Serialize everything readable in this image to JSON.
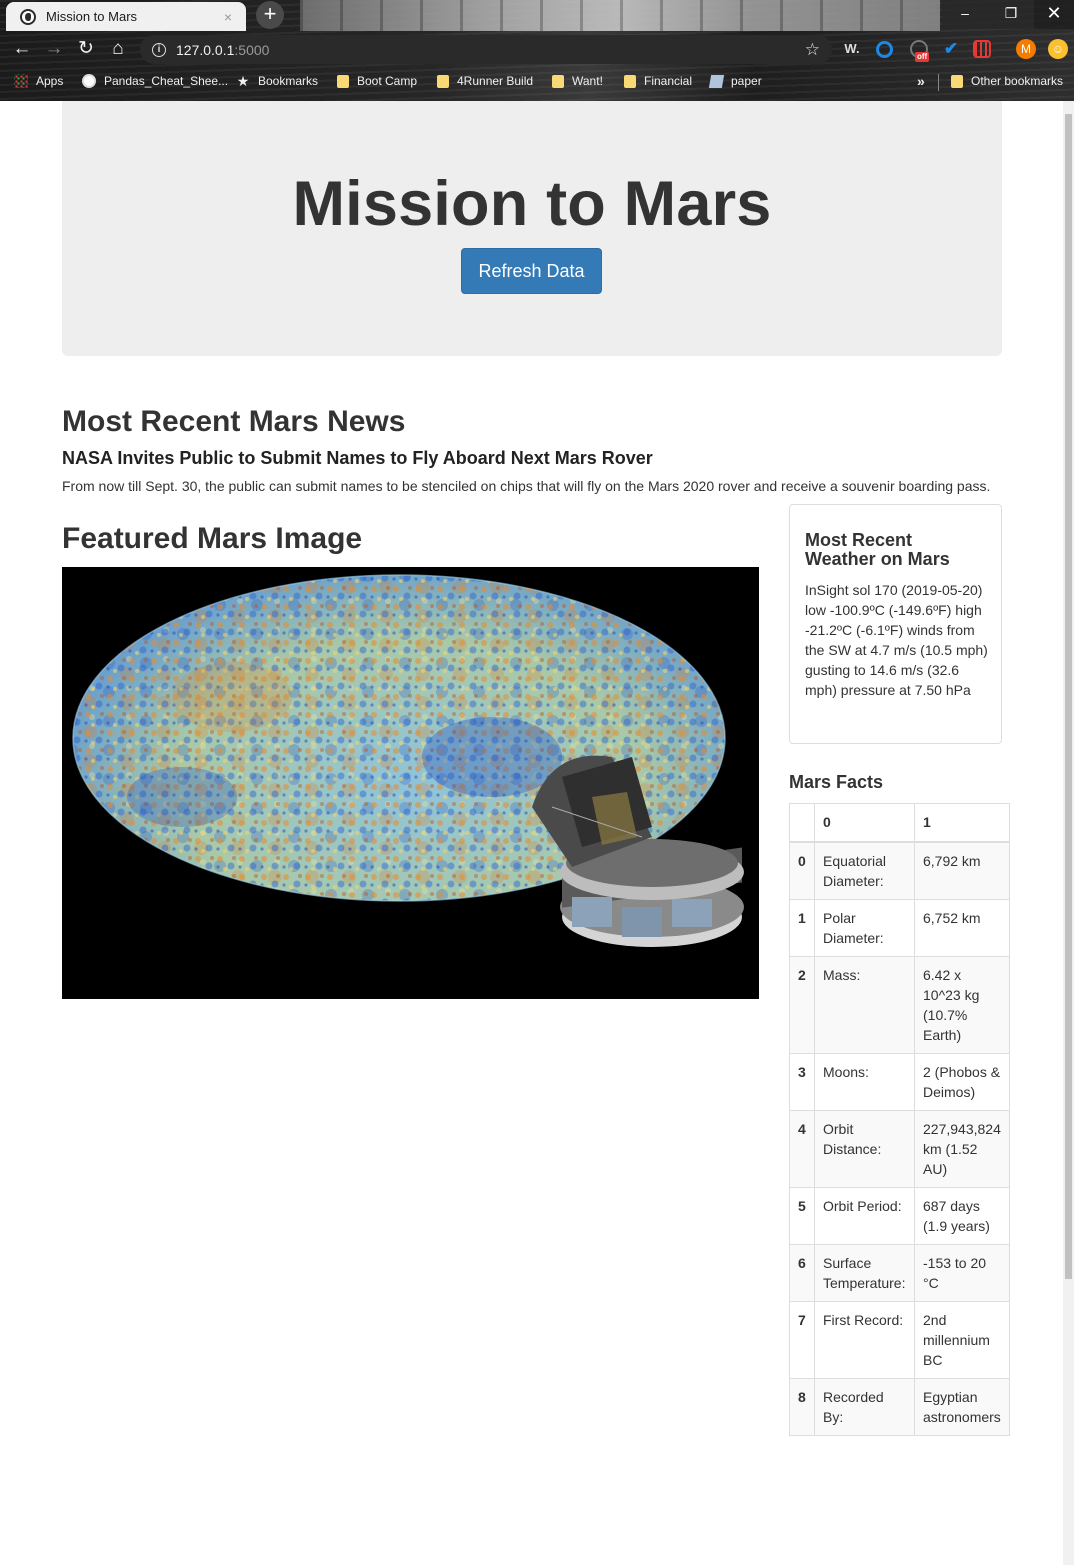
{
  "browser": {
    "tab_title": "Mission to Mars",
    "tab_close": "×",
    "new_tab": "+",
    "url_host": "127.0.0.1",
    "url_port": ":5000",
    "window_controls": {
      "minimize": "–",
      "maximize": "❐",
      "close": "✕"
    },
    "extensions": {
      "w": "W.",
      "off_badge": "off",
      "avatar": "M",
      "smile": "☺"
    },
    "bookmarks": [
      {
        "label": "Apps",
        "icon": "apps-grid-icon"
      },
      {
        "label": "Pandas_Cheat_Shee...",
        "icon": "globe-icon"
      },
      {
        "label": "Bookmarks",
        "icon": "star-icon"
      },
      {
        "label": "Boot Camp",
        "icon": "folder-icon"
      },
      {
        "label": "4Runner Build",
        "icon": "folder-icon"
      },
      {
        "label": "Want!",
        "icon": "folder-icon"
      },
      {
        "label": "Financial",
        "icon": "folder-icon"
      },
      {
        "label": "paper",
        "icon": "paper-icon"
      }
    ],
    "bookmarks_overflow": "»",
    "other_bookmarks": "Other bookmarks"
  },
  "jumbotron": {
    "title": "Mission to Mars",
    "refresh_button": "Refresh Data"
  },
  "news": {
    "section_title": "Most Recent Mars News",
    "headline": "NASA Invites Public to Submit Names to Fly Aboard Next Mars Rover",
    "teaser": "From now till Sept. 30, the public can submit names to be stenciled on chips that will fly on the Mars 2020 rover and receive a souvenir boarding pass."
  },
  "featured_image": {
    "section_title": "Featured Mars Image"
  },
  "weather": {
    "title": "Most Recent Weather on Mars",
    "text": "InSight sol 170 (2019-05-20) low -100.9ºC (-149.6ºF) high -21.2ºC (-6.1ºF) winds from the SW at 4.7 m/s (10.5 mph) gusting to 14.6 m/s (32.6 mph) pressure at 7.50 hPa"
  },
  "facts": {
    "title": "Mars Facts",
    "headers": [
      "",
      "0",
      "1"
    ],
    "rows": [
      {
        "index": "0",
        "label": "Equatorial Diameter:",
        "value": "6,792 km"
      },
      {
        "index": "1",
        "label": "Polar Diameter:",
        "value": "6,752 km"
      },
      {
        "index": "2",
        "label": "Mass:",
        "value": "6.42 x 10^23 kg (10.7% Earth)"
      },
      {
        "index": "3",
        "label": "Moons:",
        "value": "2 (Phobos & Deimos)"
      },
      {
        "index": "4",
        "label": "Orbit Distance:",
        "value": "227,943,824 km (1.52 AU)"
      },
      {
        "index": "5",
        "label": "Orbit Period:",
        "value": "687 days (1.9 years)"
      },
      {
        "index": "6",
        "label": "Surface Temperature:",
        "value": "-153 to 20 °C"
      },
      {
        "index": "7",
        "label": "First Record:",
        "value": "2nd millennium BC"
      },
      {
        "index": "8",
        "label": "Recorded By:",
        "value": "Egyptian astronomers"
      }
    ]
  },
  "colors": {
    "primary_button": "#337ab7",
    "jumbotron_bg": "#eeeeee"
  }
}
